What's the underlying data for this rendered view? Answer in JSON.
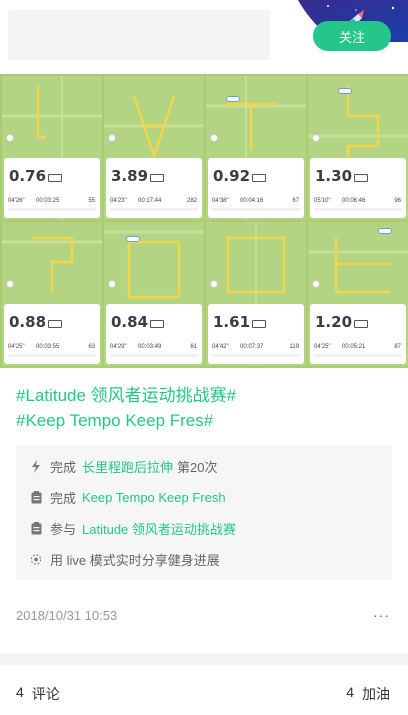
{
  "header": {
    "follow_label": "关注"
  },
  "photo": {
    "tiles": [
      {
        "pace_big": "0.76",
        "pace": "04'26\"",
        "duration": "00:03:25",
        "calories": "55"
      },
      {
        "pace_big": "3.89",
        "pace": "04'23\"",
        "duration": "00:17:44",
        "calories": "282"
      },
      {
        "pace_big": "0.92",
        "pace": "04'38\"",
        "duration": "00:04:16",
        "calories": "67"
      },
      {
        "pace_big": "1.30",
        "pace": "05'10\"",
        "duration": "00:06:46",
        "calories": "96"
      },
      {
        "pace_big": "0.88",
        "pace": "04'25\"",
        "duration": "00:03:55",
        "calories": "63"
      },
      {
        "pace_big": "0.84",
        "pace": "04'29\"",
        "duration": "00:03:49",
        "calories": "61"
      },
      {
        "pace_big": "1.61",
        "pace": "04'42\"",
        "duration": "00:07:37",
        "calories": "119"
      },
      {
        "pace_big": "1.20",
        "pace": "04'25\"",
        "duration": "00:05:21",
        "calories": "87"
      }
    ]
  },
  "post": {
    "hashtags": [
      "#Latitude 领风者运动挑战赛#",
      "#Keep Tempo Keep Fres#"
    ]
  },
  "achievements": {
    "items": [
      {
        "icon": "lightning-icon",
        "verb": "完成",
        "highlight": "长里程跑后拉伸",
        "after": "第20次"
      },
      {
        "icon": "clipboard-icon",
        "verb": "完成",
        "highlight": "Keep Tempo Keep Fresh",
        "after": ""
      },
      {
        "icon": "clipboard-icon",
        "verb": "参与",
        "highlight": "Latitude 领风者运动挑战赛",
        "after": ""
      },
      {
        "icon": "live-broadcast-icon",
        "verb": "用 live 模式实时分享健身进展",
        "highlight": "",
        "after": ""
      }
    ]
  },
  "meta": {
    "timestamp": "2018/10/31 10:53",
    "more_label": "···"
  },
  "stats": {
    "comments_count": "4",
    "comments_label": "评论",
    "cheers_count": "4",
    "cheers_label": "加油"
  },
  "colors": {
    "accent": "#24c789",
    "map_green": "#b3d483",
    "route_yellow": "#f2d54a"
  }
}
